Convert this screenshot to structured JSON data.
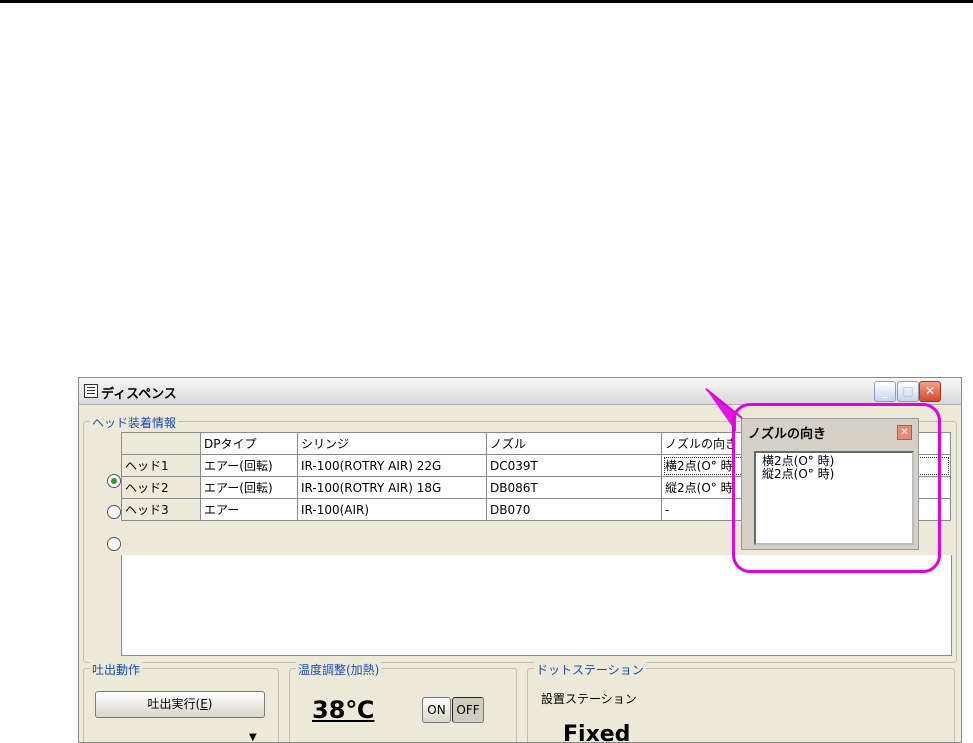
{
  "window": {
    "title": "ディスペンス"
  },
  "head_group": {
    "label": "ヘッド装着情報",
    "columns": [
      "",
      "DPタイプ",
      "シリンジ",
      "ノズル",
      "ノズルの向き"
    ],
    "rows": [
      {
        "name": "ヘッド1",
        "dp_type": "エアー(回転)",
        "syringe": "IR-100(ROTRY AIR) 22G",
        "nozzle": "DC039T",
        "direction": "横2点(O° 時",
        "selected": true
      },
      {
        "name": "ヘッド2",
        "dp_type": "エアー(回転)",
        "syringe": "IR-100(ROTRY AIR) 18G",
        "nozzle": "DB086T",
        "direction": "縦2点(O° 時",
        "selected": false
      },
      {
        "name": "ヘッド3",
        "dp_type": "エアー",
        "syringe": "IR-100(AIR)",
        "nozzle": "DB070",
        "direction": "-",
        "selected": false
      }
    ]
  },
  "discharge_group": {
    "label": "吐出動作",
    "run_button": "吐出実行(",
    "run_button_key": "E",
    "run_button_end": ")"
  },
  "temp_group": {
    "label": "温度調整(加熱)",
    "value": "38℃",
    "on_label": "ON",
    "off_label": "OFF"
  },
  "dot_group": {
    "label": "ドットステーション",
    "station_label": "設置ステーション",
    "station_value": "Fixed"
  },
  "popup": {
    "title": "ノズルの向き",
    "items": [
      "横2点(O° 時)",
      "縦2点(O° 時)"
    ]
  },
  "colors": {
    "callout": "#e000e0",
    "group_label": "#1a4bb8",
    "panel": "#ece9d8"
  }
}
